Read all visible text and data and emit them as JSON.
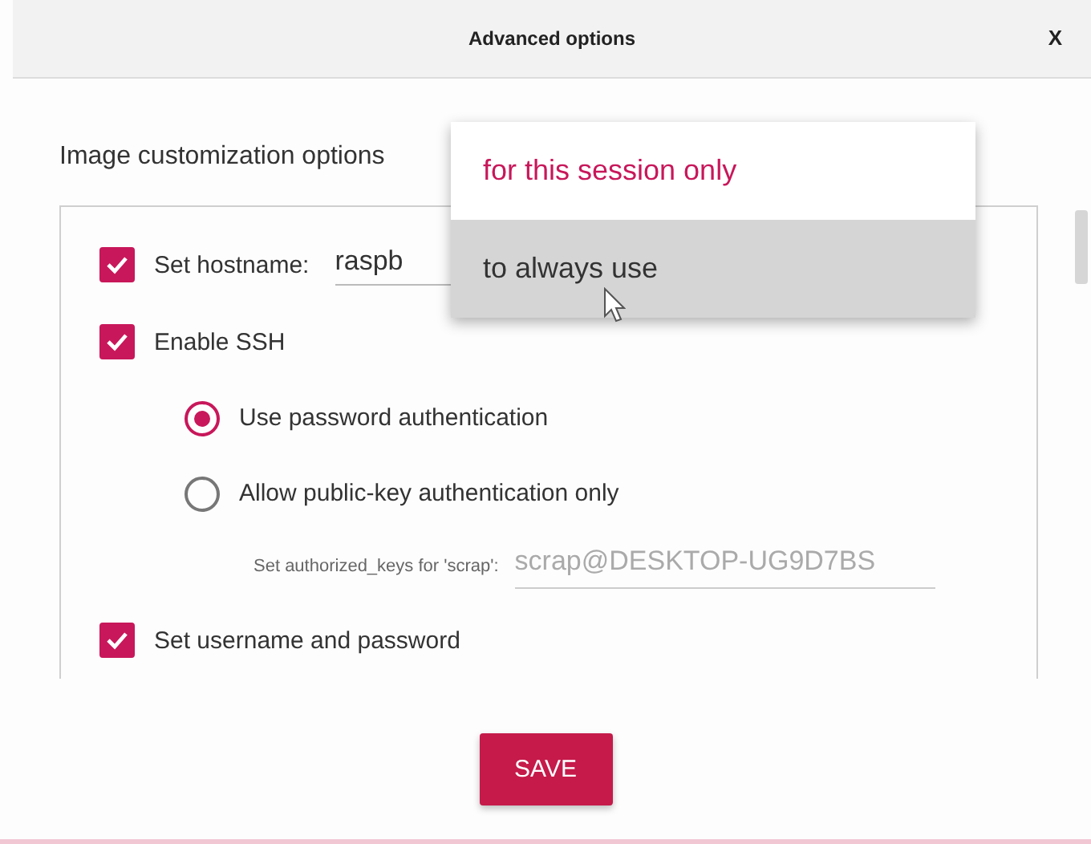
{
  "window": {
    "title": "Advanced options",
    "close": "X"
  },
  "section_title": "Image customization options",
  "options": [
    {
      "kind": "checkbox",
      "label": "Set hostname:",
      "checked": true,
      "value": "raspb"
    },
    {
      "kind": "checkbox",
      "label": "Enable SSH",
      "checked": true
    },
    {
      "kind": "radio",
      "label": "Use password authentication",
      "selected": true
    },
    {
      "kind": "radio",
      "label": "Allow public-key authentication only",
      "selected": false
    },
    {
      "kind": "keyfield",
      "label": "Set authorized_keys for 'scrap':",
      "placeholder": "scrap@DESKTOP-UG9D7BS"
    },
    {
      "kind": "checkbox",
      "label": "Set username and password",
      "checked": true
    }
  ],
  "dropdown": [
    {
      "label": "for this session only",
      "current": true,
      "selected": false
    },
    {
      "label": "to always use",
      "current": false,
      "selected": true
    }
  ],
  "save_button": "SAVE"
}
